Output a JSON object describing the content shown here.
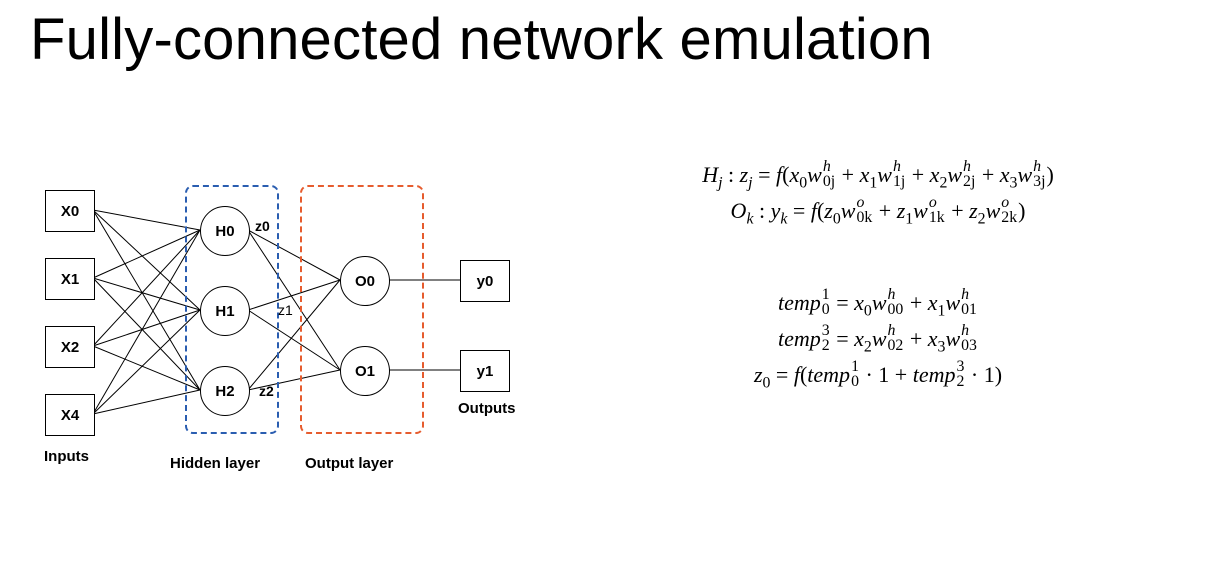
{
  "title": "Fully-connected network emulation",
  "diagram": {
    "inputs_label": "Inputs",
    "hidden_label": "Hidden layer",
    "output_label": "Output layer",
    "outputs_label": "Outputs",
    "inputs": [
      "X0",
      "X1",
      "X2",
      "X4"
    ],
    "hidden": [
      "H0",
      "H1",
      "H2"
    ],
    "z_labels": [
      "z0",
      "z1",
      "z2"
    ],
    "outputs_nodes": [
      "O0",
      "O1"
    ],
    "outputs": [
      "y0",
      "y1"
    ]
  },
  "equations": {
    "line1": {
      "prefix": "H",
      "prefix_sub": "j",
      "lhs_var": "z",
      "lhs_sub": "j",
      "terms": [
        {
          "x": "x",
          "xi": "0",
          "w": "w",
          "wsup": "h",
          "wsub": "0j"
        },
        {
          "x": "x",
          "xi": "1",
          "w": "w",
          "wsup": "h",
          "wsub": "1j"
        },
        {
          "x": "x",
          "xi": "2",
          "w": "w",
          "wsup": "h",
          "wsub": "2j"
        },
        {
          "x": "x",
          "xi": "3",
          "w": "w",
          "wsup": "h",
          "wsub": "3j"
        }
      ]
    },
    "line2": {
      "prefix": "O",
      "prefix_sub": "k",
      "lhs_var": "y",
      "lhs_sub": "k",
      "terms": [
        {
          "x": "z",
          "xi": "0",
          "w": "w",
          "wsup": "o",
          "wsub": "0k"
        },
        {
          "x": "z",
          "xi": "1",
          "w": "w",
          "wsup": "o",
          "wsub": "1k"
        },
        {
          "x": "z",
          "xi": "2",
          "w": "w",
          "wsup": "o",
          "wsub": "2k"
        }
      ]
    },
    "line3": {
      "lhs_name": "temp",
      "lhs_sup": "1",
      "lhs_sub": "0",
      "terms": [
        {
          "x": "x",
          "xi": "0",
          "w": "w",
          "wsup": "h",
          "wsub": "00"
        },
        {
          "x": "x",
          "xi": "1",
          "w": "w",
          "wsup": "h",
          "wsub": "01"
        }
      ]
    },
    "line4": {
      "lhs_name": "temp",
      "lhs_sup": "3",
      "lhs_sub": "2",
      "terms": [
        {
          "x": "x",
          "xi": "2",
          "w": "w",
          "wsup": "h",
          "wsub": "02"
        },
        {
          "x": "x",
          "xi": "3",
          "w": "w",
          "wsup": "h",
          "wsub": "03"
        }
      ]
    },
    "line5": {
      "lhs_var": "z",
      "lhs_sub": "0",
      "a_name": "temp",
      "a_sup": "1",
      "a_sub": "0",
      "b_name": "temp",
      "b_sup": "3",
      "b_sub": "2",
      "const": "1"
    }
  }
}
